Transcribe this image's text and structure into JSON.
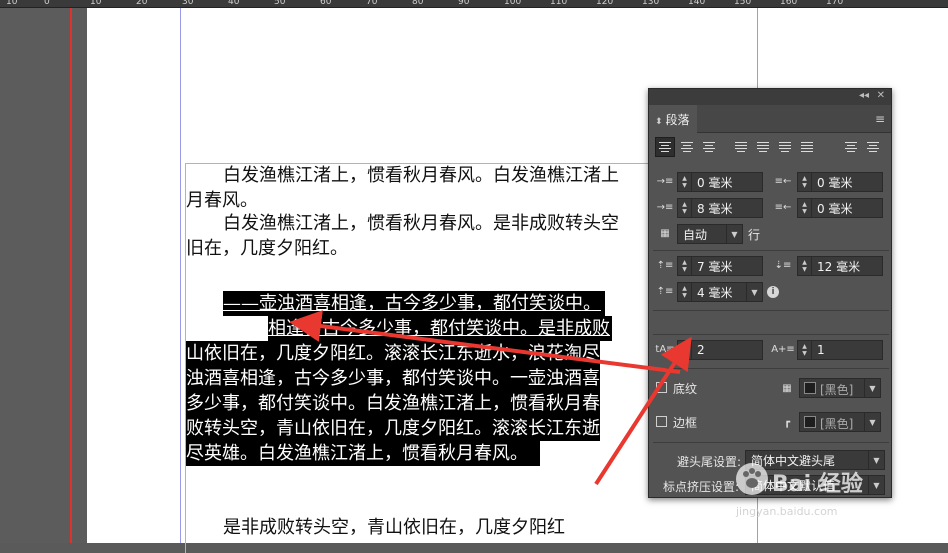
{
  "ruler": {
    "labels": [
      "10",
      "0",
      "10",
      "20",
      "30",
      "40",
      "50",
      "60",
      "70",
      "80",
      "90",
      "100",
      "110",
      "120",
      "130",
      "140",
      "150",
      "160",
      "170"
    ]
  },
  "document": {
    "lines": [
      "白发渔樵江渚上，惯看秋月春风。白发渔樵江渚上",
      "月春风。",
      "白发渔樵江渚上，惯看秋月春风。是非成败转头空",
      "旧在，几度夕阳红。",
      "——壶浊酒喜相逢，古今多少事，都付笑谈中。",
      "相逢，古今多少事，都付笑谈中。是非成败",
      "山依旧在，几度夕阳红。滚滚长江东逝水，浪花淘尽",
      "浊酒喜相逢，古今多少事，都付笑谈中。一壶浊酒喜",
      "多少事，都付笑谈中。白发渔樵江渚上，惯看秋月春",
      "败转头空，青山依旧在，几度夕阳红。滚滚长江东逝",
      "尽英雄。白发渔樵江渚上，惯看秋月春风。",
      "是非成败转头空，青山依旧在，几度夕阳红"
    ]
  },
  "panel": {
    "title": "段落",
    "left_indent": "0 毫米",
    "right_indent": "0 毫米",
    "first_line_indent": "8 毫米",
    "last_line_indent": "0 毫米",
    "auto_leading": "自动",
    "auto_leading_unit": "行",
    "space_before": "7 毫米",
    "space_after": "12 毫米",
    "space_between": "4 毫米",
    "drop_cap_lines": "2",
    "drop_cap_chars": "1",
    "shading_label": "底纹",
    "shading_color": "[黑色]",
    "border_label": "边框",
    "border_color": "[黑色]",
    "kinsoku_label": "避头尾设置:",
    "kinsoku_value": "简体中文避头尾",
    "mojikumi_label": "标点挤压设置:",
    "mojikumi_value": "简体中文默认值"
  },
  "colors": {
    "arrow": "#e8382f",
    "panel_bg": "#535353",
    "highlight": "#000000"
  }
}
